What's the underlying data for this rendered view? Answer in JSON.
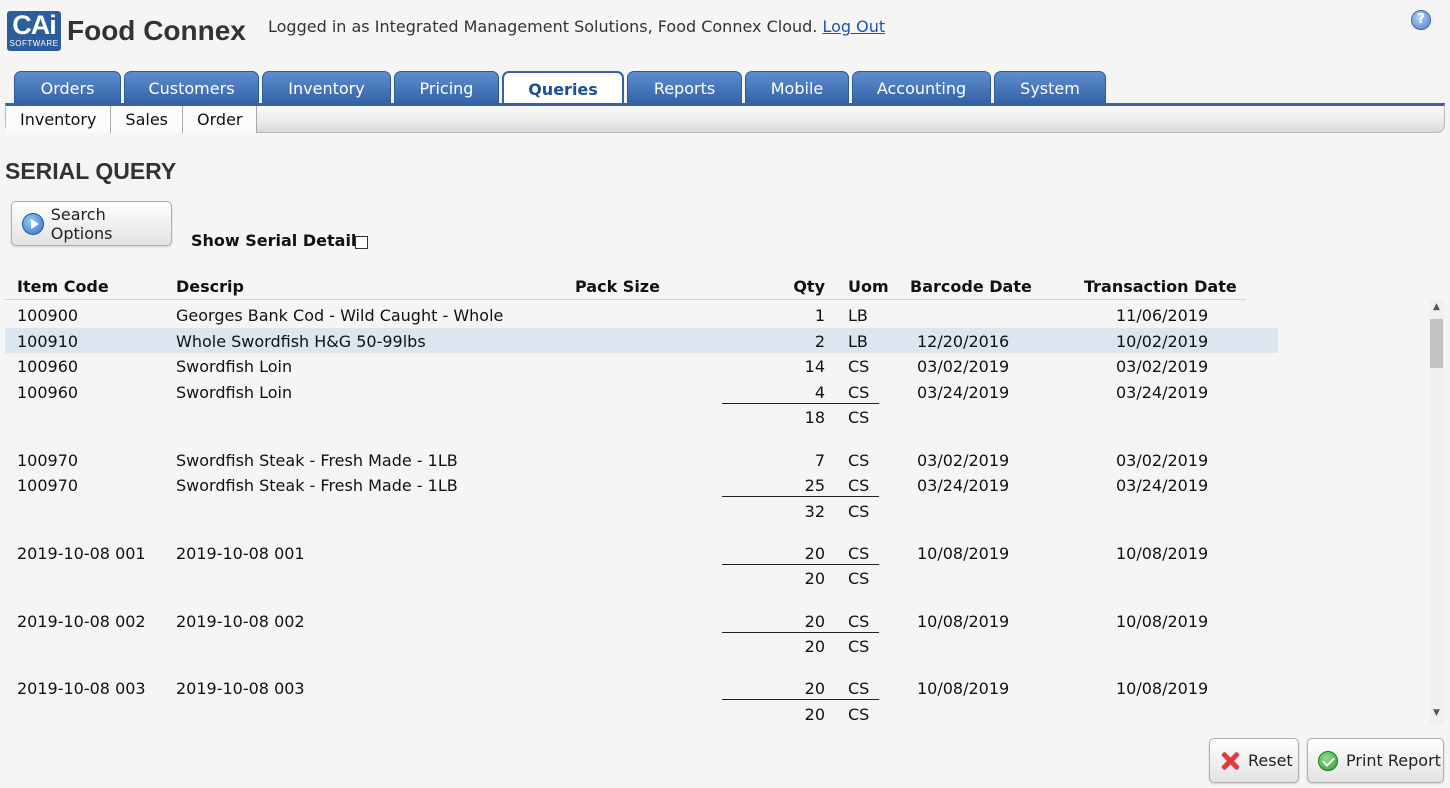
{
  "header": {
    "logo_main": "CAi",
    "logo_sub": "SOFTWARE",
    "app_name": "Food Connex",
    "login_text": "Logged in as Integrated Management Solutions, Food Connex Cloud.",
    "logout_label": "Log Out",
    "help_label": "?"
  },
  "tabs": [
    {
      "label": "Orders",
      "active": false
    },
    {
      "label": "Customers",
      "active": false
    },
    {
      "label": "Inventory",
      "active": false
    },
    {
      "label": "Pricing",
      "active": false
    },
    {
      "label": "Queries",
      "active": true
    },
    {
      "label": "Reports",
      "active": false
    },
    {
      "label": "Mobile",
      "active": false
    },
    {
      "label": "Accounting",
      "active": false
    },
    {
      "label": "System",
      "active": false
    }
  ],
  "subnav": [
    "Inventory",
    "Sales",
    "Order"
  ],
  "page_title": "SERIAL QUERY",
  "search_options_label": "Search Options",
  "show_serial_detail_label": "Show Serial Detail",
  "columns": {
    "item_code": "Item Code",
    "descrip": "Descrip",
    "pack_size": "Pack Size",
    "qty": "Qty",
    "uom": "Uom",
    "barcode_date": "Barcode Date",
    "transaction_date": "Transaction Date"
  },
  "rows": [
    {
      "type": "item",
      "code": "100900",
      "descrip": "Georges Bank Cod - Wild Caught - Whole",
      "qty": "1",
      "uom": "LB",
      "barcode_date": "",
      "transaction_date": "11/06/2019"
    },
    {
      "type": "item",
      "code": "100910",
      "descrip": "Whole Swordfish H&G 50-99lbs",
      "qty": "2",
      "uom": "LB",
      "barcode_date": "12/20/2016",
      "transaction_date": "10/02/2019",
      "selected": true
    },
    {
      "type": "item",
      "code": "100960",
      "descrip": "Swordfish Loin",
      "qty": "14",
      "uom": "CS",
      "barcode_date": "03/02/2019",
      "transaction_date": "03/02/2019"
    },
    {
      "type": "item",
      "code": "100960",
      "descrip": "Swordfish Loin",
      "qty": "4",
      "uom": "CS",
      "barcode_date": "03/24/2019",
      "transaction_date": "03/24/2019",
      "underline": true
    },
    {
      "type": "subtotal",
      "qty": "18",
      "uom": "CS"
    },
    {
      "type": "spacer"
    },
    {
      "type": "item",
      "code": "100970",
      "descrip": "Swordfish Steak - Fresh Made - 1LB",
      "qty": "7",
      "uom": "CS",
      "barcode_date": "03/02/2019",
      "transaction_date": "03/02/2019"
    },
    {
      "type": "item",
      "code": "100970",
      "descrip": "Swordfish Steak - Fresh Made - 1LB",
      "qty": "25",
      "uom": "CS",
      "barcode_date": "03/24/2019",
      "transaction_date": "03/24/2019",
      "underline": true
    },
    {
      "type": "subtotal",
      "qty": "32",
      "uom": "CS"
    },
    {
      "type": "spacer"
    },
    {
      "type": "item",
      "code": "2019-10-08 001",
      "descrip": "2019-10-08 001",
      "qty": "20",
      "uom": "CS",
      "barcode_date": "10/08/2019",
      "transaction_date": "10/08/2019",
      "underline": true
    },
    {
      "type": "subtotal",
      "qty": "20",
      "uom": "CS"
    },
    {
      "type": "spacer"
    },
    {
      "type": "item",
      "code": "2019-10-08 002",
      "descrip": "2019-10-08 002",
      "qty": "20",
      "uom": "CS",
      "barcode_date": "10/08/2019",
      "transaction_date": "10/08/2019",
      "underline": true
    },
    {
      "type": "subtotal",
      "qty": "20",
      "uom": "CS"
    },
    {
      "type": "spacer"
    },
    {
      "type": "item",
      "code": "2019-10-08 003",
      "descrip": "2019-10-08 003",
      "qty": "20",
      "uom": "CS",
      "barcode_date": "10/08/2019",
      "transaction_date": "10/08/2019",
      "underline": true
    },
    {
      "type": "subtotal",
      "qty": "20",
      "uom": "CS"
    }
  ],
  "buttons": {
    "reset": "Reset",
    "print_report": "Print Report"
  }
}
